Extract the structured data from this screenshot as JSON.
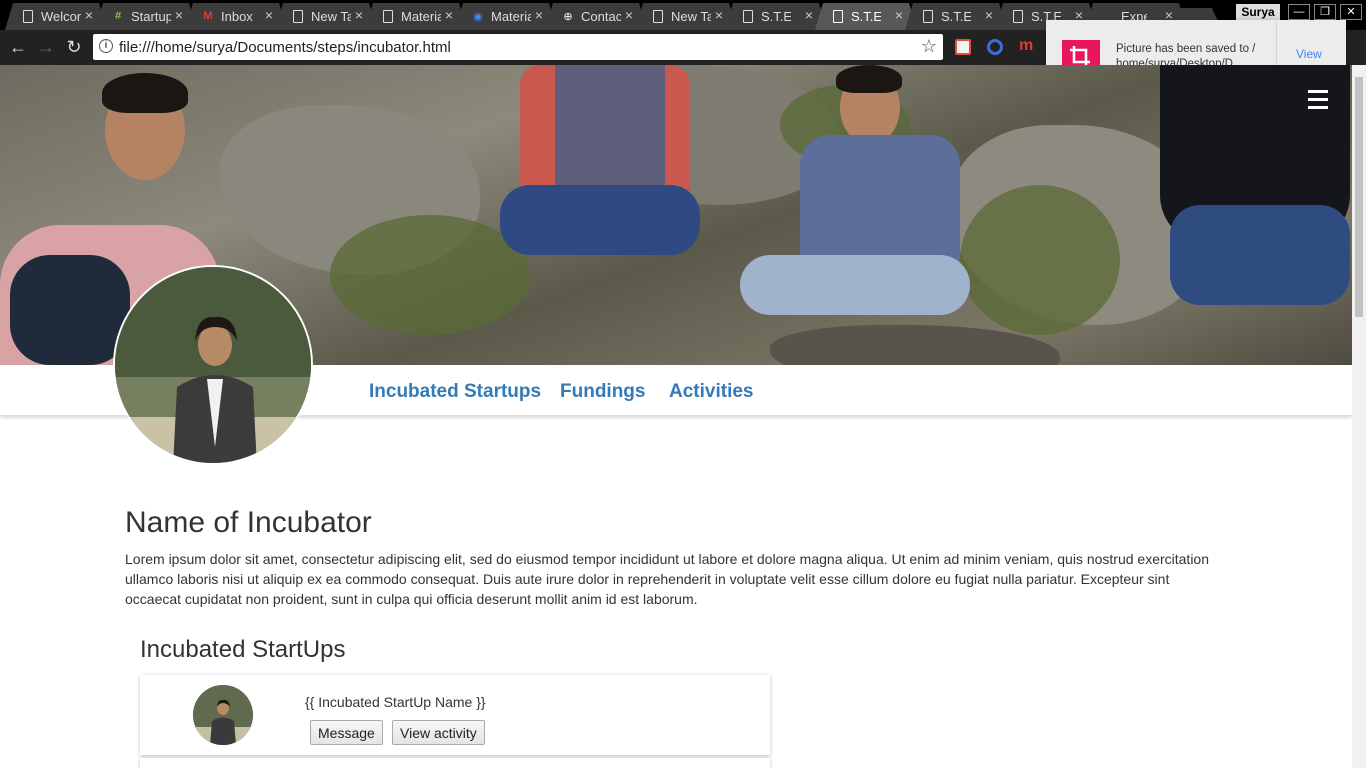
{
  "browser": {
    "tabs": [
      {
        "title": "Welcome",
        "icon": "doc-icon",
        "active": false
      },
      {
        "title": "Startups",
        "icon": "startup-favicon",
        "active": false
      },
      {
        "title": "Inbox",
        "icon": "gmail-icon",
        "active": false
      },
      {
        "title": "New Tab",
        "icon": "doc-icon",
        "active": false
      },
      {
        "title": "Material",
        "icon": "doc-icon",
        "active": false
      },
      {
        "title": "Material",
        "icon": "chrome-icon",
        "active": false
      },
      {
        "title": "Contacts",
        "icon": "google-contacts-icon",
        "active": false
      },
      {
        "title": "New Tab",
        "icon": "doc-icon",
        "active": false
      },
      {
        "title": "S.T.E.P.S",
        "icon": "doc-icon",
        "active": false
      },
      {
        "title": "S.T.E.P.S",
        "icon": "doc-icon",
        "active": true
      },
      {
        "title": "S.T.E.P.S",
        "icon": "doc-icon",
        "active": false
      },
      {
        "title": "S.T.E.P.S",
        "icon": "doc-icon",
        "active": false
      },
      {
        "title": "Experiments",
        "icon": "none",
        "active": false
      }
    ],
    "profile_name": "Surya",
    "url": "file:///home/surya/Documents/steps/incubator.html"
  },
  "notification": {
    "text": "Picture has been saved to / home/surya/Desktop/D...",
    "action": "View"
  },
  "nav": {
    "links": [
      "Incubated Startups",
      "Fundings",
      "Activities"
    ]
  },
  "profile": {
    "name": "Name of Incubator",
    "description": "Lorem ipsum dolor sit amet, consectetur adipiscing elit, sed do eiusmod tempor incididunt ut labore et dolore magna aliqua. Ut enim ad minim veniam, quis nostrud exercitation ullamco laboris nisi ut aliquip ex ea commodo consequat. Duis aute irure dolor in reprehenderit in voluptate velit esse cillum dolore eu fugiat nulla pariatur. Excepteur sint occaecat cupidatat non proident, sunt in culpa qui officia deserunt mollit anim id est laborum."
  },
  "startups": {
    "heading": "Incubated StartUps",
    "items": [
      {
        "name": "{{ Incubated StartUp Name }}",
        "message_label": "Message",
        "activity_label": "View activity"
      }
    ]
  },
  "colors": {
    "link": "#337ab7",
    "notification_icon": "#e8175d",
    "notification_action": "#4285f4"
  }
}
